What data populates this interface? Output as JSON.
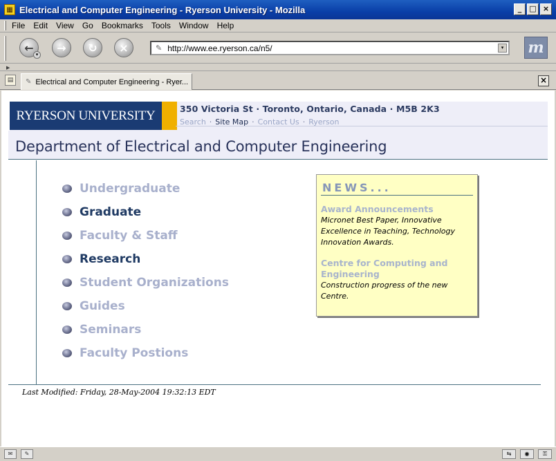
{
  "window": {
    "title": "Electrical and Computer Engineering - Ryerson University - Mozilla"
  },
  "menubar": {
    "items": [
      "File",
      "Edit",
      "View",
      "Go",
      "Bookmarks",
      "Tools",
      "Window",
      "Help"
    ]
  },
  "navigation": {
    "url": "http://www.ee.ryerson.ca/n5/"
  },
  "tab": {
    "label": "Electrical and Computer Engineering - Ryer..."
  },
  "header": {
    "logo_text": "RYERSON UNIVERSITY",
    "address": "350 Victoria St · Toronto, Ontario, Canada · M5B 2K3",
    "links": [
      "Search",
      "Site Map",
      "Contact Us",
      "Ryerson"
    ],
    "separator": "·"
  },
  "page": {
    "title": "Department of Electrical and Computer Engineering",
    "menu": [
      {
        "label": "Undergraduate",
        "style": "light"
      },
      {
        "label": "Graduate",
        "style": "dark"
      },
      {
        "label": "Faculty & Staff",
        "style": "light"
      },
      {
        "label": "Research",
        "style": "dark"
      },
      {
        "label": "Student Organizations",
        "style": "light"
      },
      {
        "label": "Guides",
        "style": "light"
      },
      {
        "label": "Seminars",
        "style": "light"
      },
      {
        "label": "Faculty Postions",
        "style": "light"
      }
    ],
    "last_modified": "Last Modified: Friday, 28-May-2004 19:32:13 EDT"
  },
  "news": {
    "title": "NEWS...",
    "items": [
      {
        "heading": "Award Announcements",
        "body": "Micronet Best Paper, Innovative Excellence in Teaching, Technology Innovation Awards."
      },
      {
        "heading": "Centre for Computing and Engineering",
        "body": "Construction progress of the new Centre."
      }
    ]
  },
  "icons": {
    "app": "mozilla-app-icon",
    "back": "back-arrow-icon",
    "forward": "forward-arrow-icon",
    "reload": "reload-icon",
    "stop": "stop-icon",
    "throbber": "mozilla-m-logo-icon"
  }
}
